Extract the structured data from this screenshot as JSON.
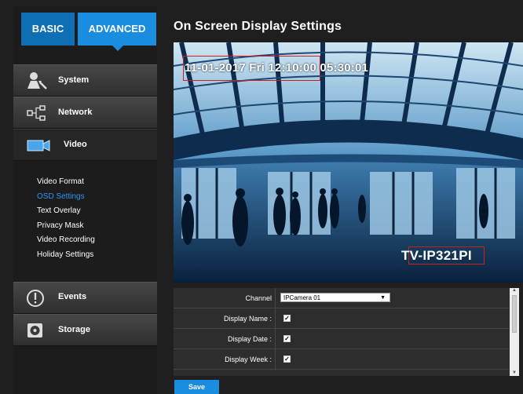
{
  "top_tabs": {
    "basic": "BASIC",
    "advanced": "ADVANCED"
  },
  "sidebar": {
    "items": [
      {
        "label": "System",
        "icon": "system-icon"
      },
      {
        "label": "Network",
        "icon": "network-icon"
      },
      {
        "label": "Video",
        "icon": "video-camera-icon"
      },
      {
        "label": "Events",
        "icon": "alert-icon"
      },
      {
        "label": "Storage",
        "icon": "storage-icon"
      }
    ],
    "video_submenu": [
      "Video Format",
      "OSD Settings",
      "Text Overlay",
      "Privacy Mask",
      "Video Recording",
      "Holiday Settings"
    ],
    "active_submenu": "OSD Settings"
  },
  "page": {
    "title": "On Screen Display Settings"
  },
  "video_preview": {
    "osd_datetime": "11-01-2017 Fri 12:10:00 05:30:01",
    "osd_name": "TV-IP321PI"
  },
  "settings": {
    "channel_label": "Channel",
    "channel_value": "IPCamera 01",
    "rows": [
      {
        "label": "Display Name :",
        "checked": true
      },
      {
        "label": "Display Date :",
        "checked": true
      },
      {
        "label": "Display Week :",
        "checked": true
      }
    ]
  },
  "save_label": "Save",
  "colors": {
    "accent": "#1b8de0",
    "active_link": "#2d96f0",
    "osd_box": "#d11c1c"
  }
}
